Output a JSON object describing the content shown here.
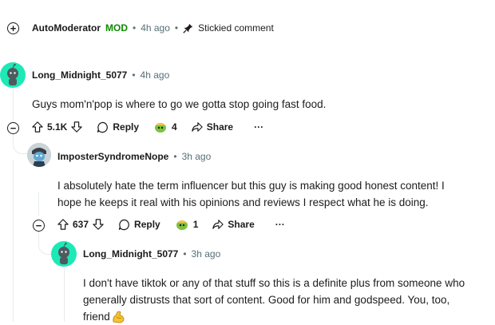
{
  "automod": {
    "username": "AutoModerator",
    "mod_badge": "MOD",
    "sep1": "•",
    "time": "4h ago",
    "sep2": "•",
    "stickied": "Stickied comment"
  },
  "comments": [
    {
      "username": "Long_Midnight_5077",
      "sep": "•",
      "time": "4h ago",
      "body": "Guys mom'n'pop is where to go we gotta stop going fast food.",
      "votes": "5.1K",
      "reply_label": "Reply",
      "award_count": "4",
      "share_label": "Share",
      "more_label": "···"
    },
    {
      "username": "ImposterSyndromeNope",
      "sep": "•",
      "time": "3h ago",
      "body_line1": "I absolutely hate the term influencer but this guy is making good honest content! I",
      "body_line2": "hope he keeps it real with his opinions and reviews I respect what he is doing.",
      "votes": "637",
      "reply_label": "Reply",
      "award_count": "1",
      "share_label": "Share",
      "more_label": "···"
    },
    {
      "username": "Long_Midnight_5077",
      "sep": "•",
      "time": "3h ago",
      "body_line1": "I don't have tiktok or any of that stuff so this is a definite plus from someone who",
      "body_line2": "generally distrusts that sort of content. Good for him and godspeed. You, too,",
      "body_line3": "friend"
    }
  ],
  "colors": {
    "mod_green": "#0e8a00",
    "avatar_teal": "#1de9b6",
    "meta_gray": "#576f76",
    "thread_line": "#e5ebee"
  }
}
